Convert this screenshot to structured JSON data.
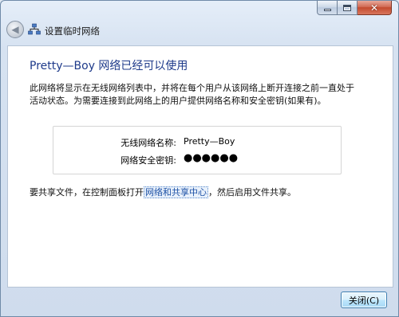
{
  "window": {
    "title": "设置临时网络",
    "caption_buttons": {
      "minimize_icon": "minimize-icon",
      "maximize_icon": "maximize-icon",
      "close_icon": "close-icon"
    }
  },
  "header": {
    "back_icon": "back-arrow-icon",
    "network_icon": "network-icon",
    "title": "设置临时网络"
  },
  "main": {
    "heading": "Pretty—Boy 网络已经可以使用",
    "description": "此网络将显示在无线网络列表中，并将在每个用户从该网络上断开连接之前一直处于活动状态。为需要连接到此网络上的用户提供网络名称和安全密钥(如果有)。",
    "info": {
      "name_label": "无线网络名称:",
      "name_value": "Pretty—Boy",
      "key_label": "网络安全密钥:",
      "key_value": "●●●●●●"
    },
    "share": {
      "prefix": "要共享文件，在控制面板打开",
      "link": "网络和共享中心",
      "suffix": "，然后启用文件共享。"
    }
  },
  "footer": {
    "close_label": "关闭(C)"
  },
  "colors": {
    "heading": "#1e3a8a",
    "link": "#1a4fa5",
    "close_caption": "#c44a2f"
  }
}
